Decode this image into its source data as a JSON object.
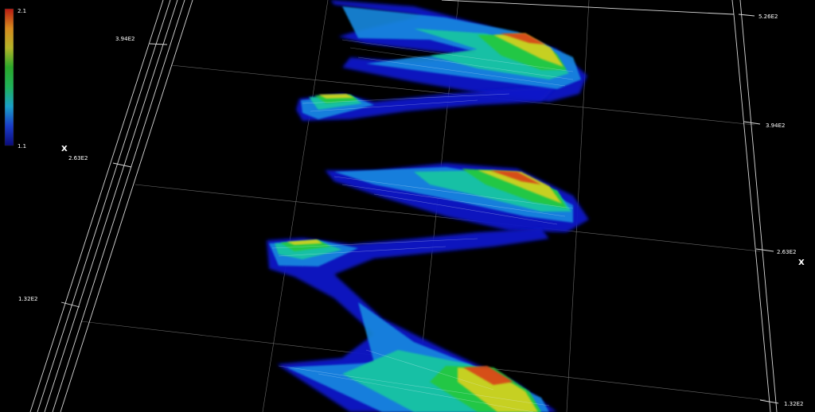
{
  "colorbar": {
    "max_label": "2.1",
    "min_label": "1.1",
    "stops": [
      "#0b0b7a",
      "#1a3cc8",
      "#1aa0c8",
      "#1fb25a",
      "#2aa82a",
      "#b4b428",
      "#d68a1e",
      "#b81a12"
    ]
  },
  "left_axis": {
    "letter": "X",
    "tick_labels": [
      "3.94E2",
      "2.63E2",
      "1.32E2"
    ]
  },
  "right_axis": {
    "letter": "X",
    "tick_labels": [
      "5.26E2",
      "3.94E2",
      "2.63E2",
      "1.32E2"
    ]
  },
  "surface_colors": {
    "low": "#0a14c8",
    "mid_low": "#1a8ae0",
    "mid": "#18c8a0",
    "mid_high": "#22c83a",
    "high": "#d8d020",
    "peak": "#d8401a"
  }
}
